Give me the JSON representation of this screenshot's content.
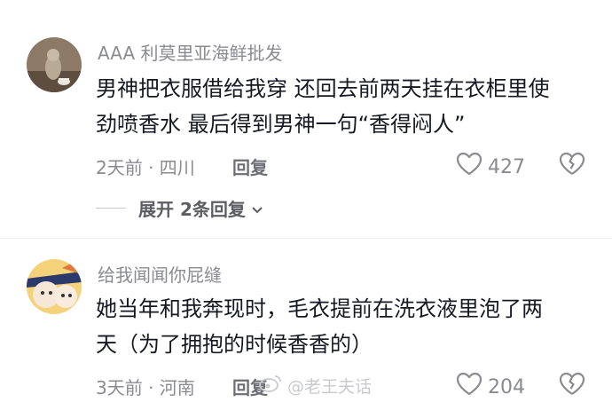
{
  "comments": [
    {
      "username": "AAA 利莫里亚海鲜批发",
      "text_line1": "男神把衣服借给我穿 还回去前两天挂在衣柜里使",
      "text_line2": "劲喷香水 最后得到男神一句“香得闷人”",
      "meta": "2天前 · 四川",
      "reply_label": "回复",
      "likes": "427",
      "expand_label": "展开 2条回复"
    },
    {
      "username": "给我闻闻你屁缝",
      "text_line1": "她当年和我奔现时，毛衣提前在洗衣液里泡了两",
      "text_line2": "天（为了拥抱的时候香香的）",
      "meta": "3天前 · 河南",
      "reply_label": "回复",
      "likes": "204"
    }
  ],
  "watermark": "@老王夫话",
  "icons": {
    "like": "heart-outline-icon",
    "dislike": "broken-heart-icon",
    "expand": "chevron-down-icon",
    "watermark": "weibo-icon"
  },
  "colors": {
    "text": "#161823",
    "secondary": "#8a8b91"
  }
}
